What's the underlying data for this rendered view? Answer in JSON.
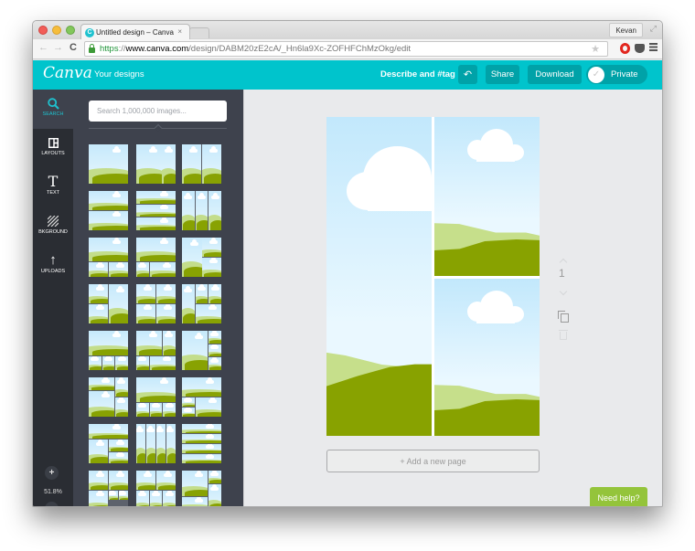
{
  "browser": {
    "tab_title": "Untitled design – Canva",
    "tab_close": "×",
    "favicon": "C",
    "profile_name": "Kevan",
    "url": {
      "scheme": "https",
      "separator": "://",
      "host": "www.canva.com",
      "path": "/design/DABM20zE2cA/_Hn6la9Xc-ZOFHFChMzOkg/edit"
    },
    "icons": {
      "back": "←",
      "forward": "→",
      "reload": "C",
      "star": "★",
      "expand": "⤢"
    }
  },
  "header": {
    "logo": "Canva",
    "your_designs": "Your designs",
    "describe": "Describe and #tag",
    "undo_icon": "↶",
    "share": "Share",
    "download": "Download",
    "private": "Private",
    "private_check": "✓"
  },
  "sidebar": {
    "items": [
      {
        "label": "SEARCH",
        "icon": "search-icon",
        "glyph": "⚲",
        "active": true
      },
      {
        "label": "LAYOUTS",
        "icon": "layouts-icon",
        "glyph": "◫",
        "active": false
      },
      {
        "label": "TEXT",
        "icon": "text-icon",
        "glyph": "T",
        "active": false
      },
      {
        "label": "BKGROUND",
        "icon": "background-icon",
        "glyph": "▨",
        "active": false
      },
      {
        "label": "UPLOADS",
        "icon": "uploads-icon",
        "glyph": "↑",
        "active": false
      }
    ],
    "zoom_in": "+",
    "zoom_out": "−",
    "zoom_level": "51.8%"
  },
  "panel": {
    "search_placeholder": "Search 1,000,000 images...",
    "layout_count": 24
  },
  "canvas": {
    "page_number": "1",
    "add_page": "+ Add a new page",
    "help": "Need help?"
  },
  "colors": {
    "brand": "#00c4cc",
    "brand_dark": "#00a2a8",
    "sidebar": "#2a2d33",
    "panel": "#3e424d",
    "help": "#94c43b"
  }
}
